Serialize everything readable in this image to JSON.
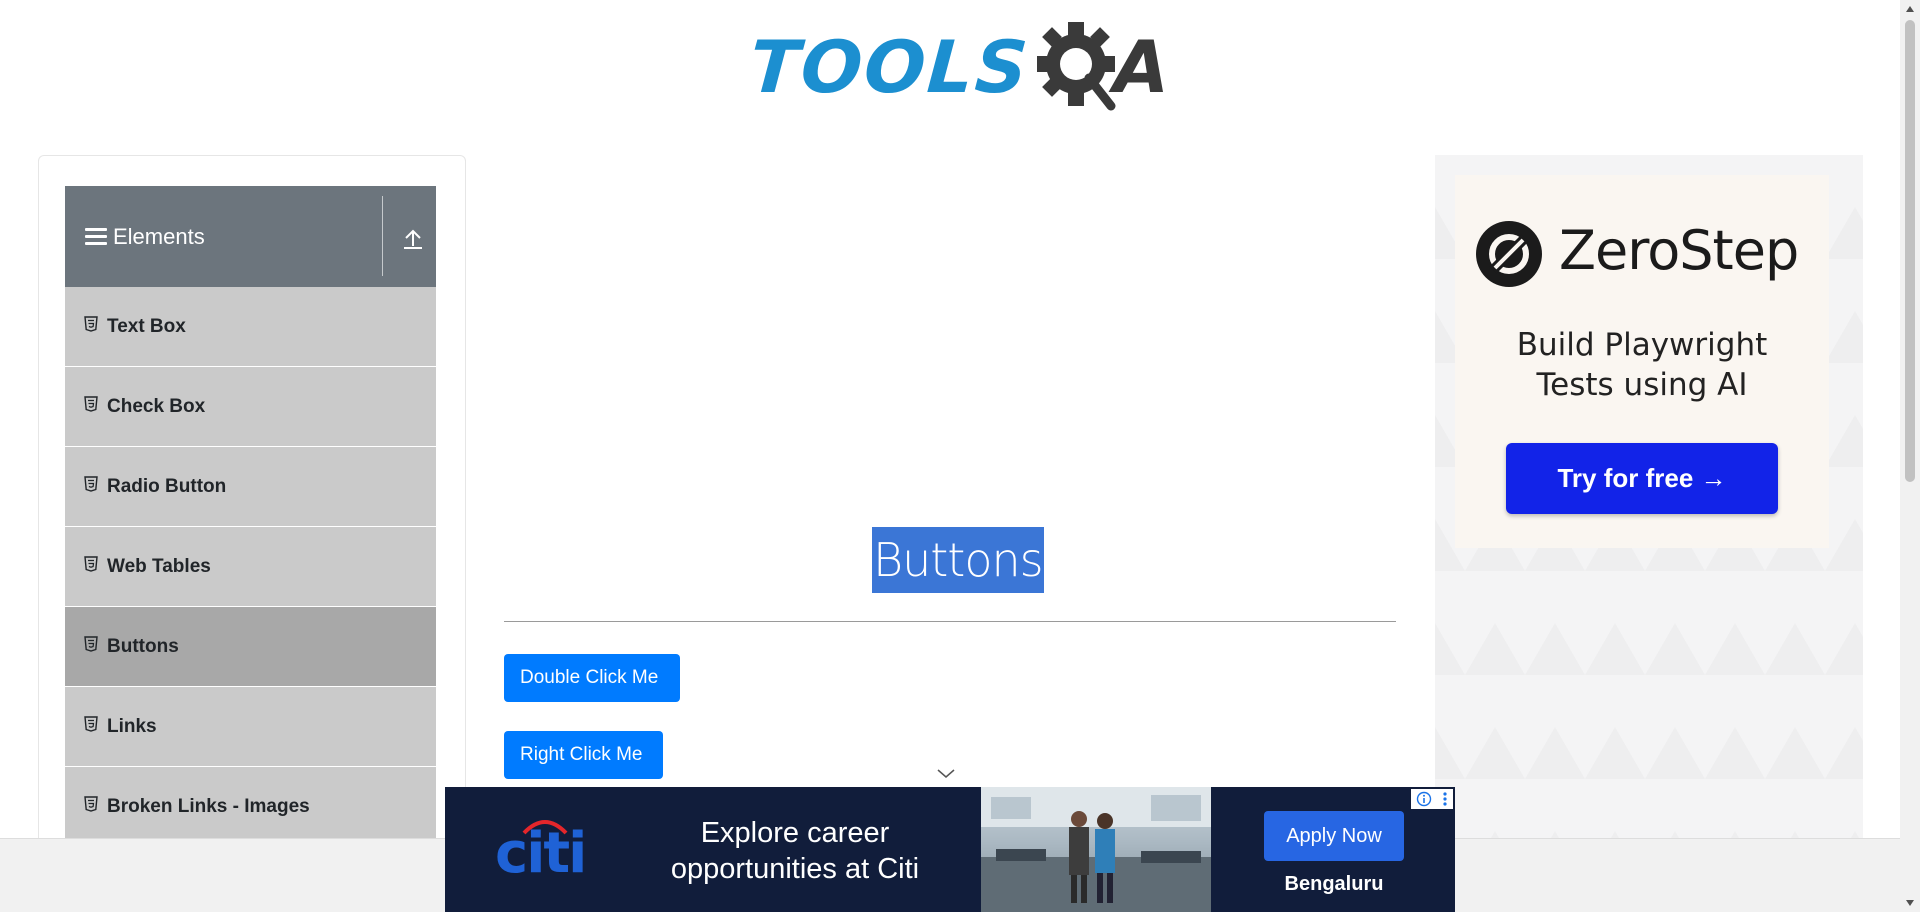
{
  "header": {
    "logo_text_tools": "TOOLS",
    "logo_text_a": "A"
  },
  "sidebar": {
    "group_title": "Elements",
    "items": [
      {
        "label": "Text Box"
      },
      {
        "label": "Check Box"
      },
      {
        "label": "Radio Button"
      },
      {
        "label": "Web Tables"
      },
      {
        "label": "Buttons"
      },
      {
        "label": "Links"
      },
      {
        "label": "Broken Links - Images"
      }
    ],
    "active_item": "Buttons"
  },
  "main": {
    "title": "Buttons",
    "buttons": {
      "double_click": "Double Click Me",
      "right_click": "Right Click Me"
    }
  },
  "side_ad": {
    "brand": "ZeroStep",
    "tagline_line1": "Build Playwright",
    "tagline_line2": "Tests using AI",
    "cta": "Try for free →"
  },
  "banner_ad": {
    "brand": "citi",
    "text_line1": "Explore career",
    "text_line2": "opportunities at Citi",
    "cta": "Apply Now",
    "location": "Bengaluru"
  },
  "colors": {
    "accent": "#007bff",
    "sidebar_header": "#6c757d",
    "menu_item": "#cacaca",
    "menu_item_active": "#a8a8a8",
    "title_selection": "#3b76d6",
    "ad_cta": "#1223e8",
    "banner_bg": "#111d3b"
  }
}
